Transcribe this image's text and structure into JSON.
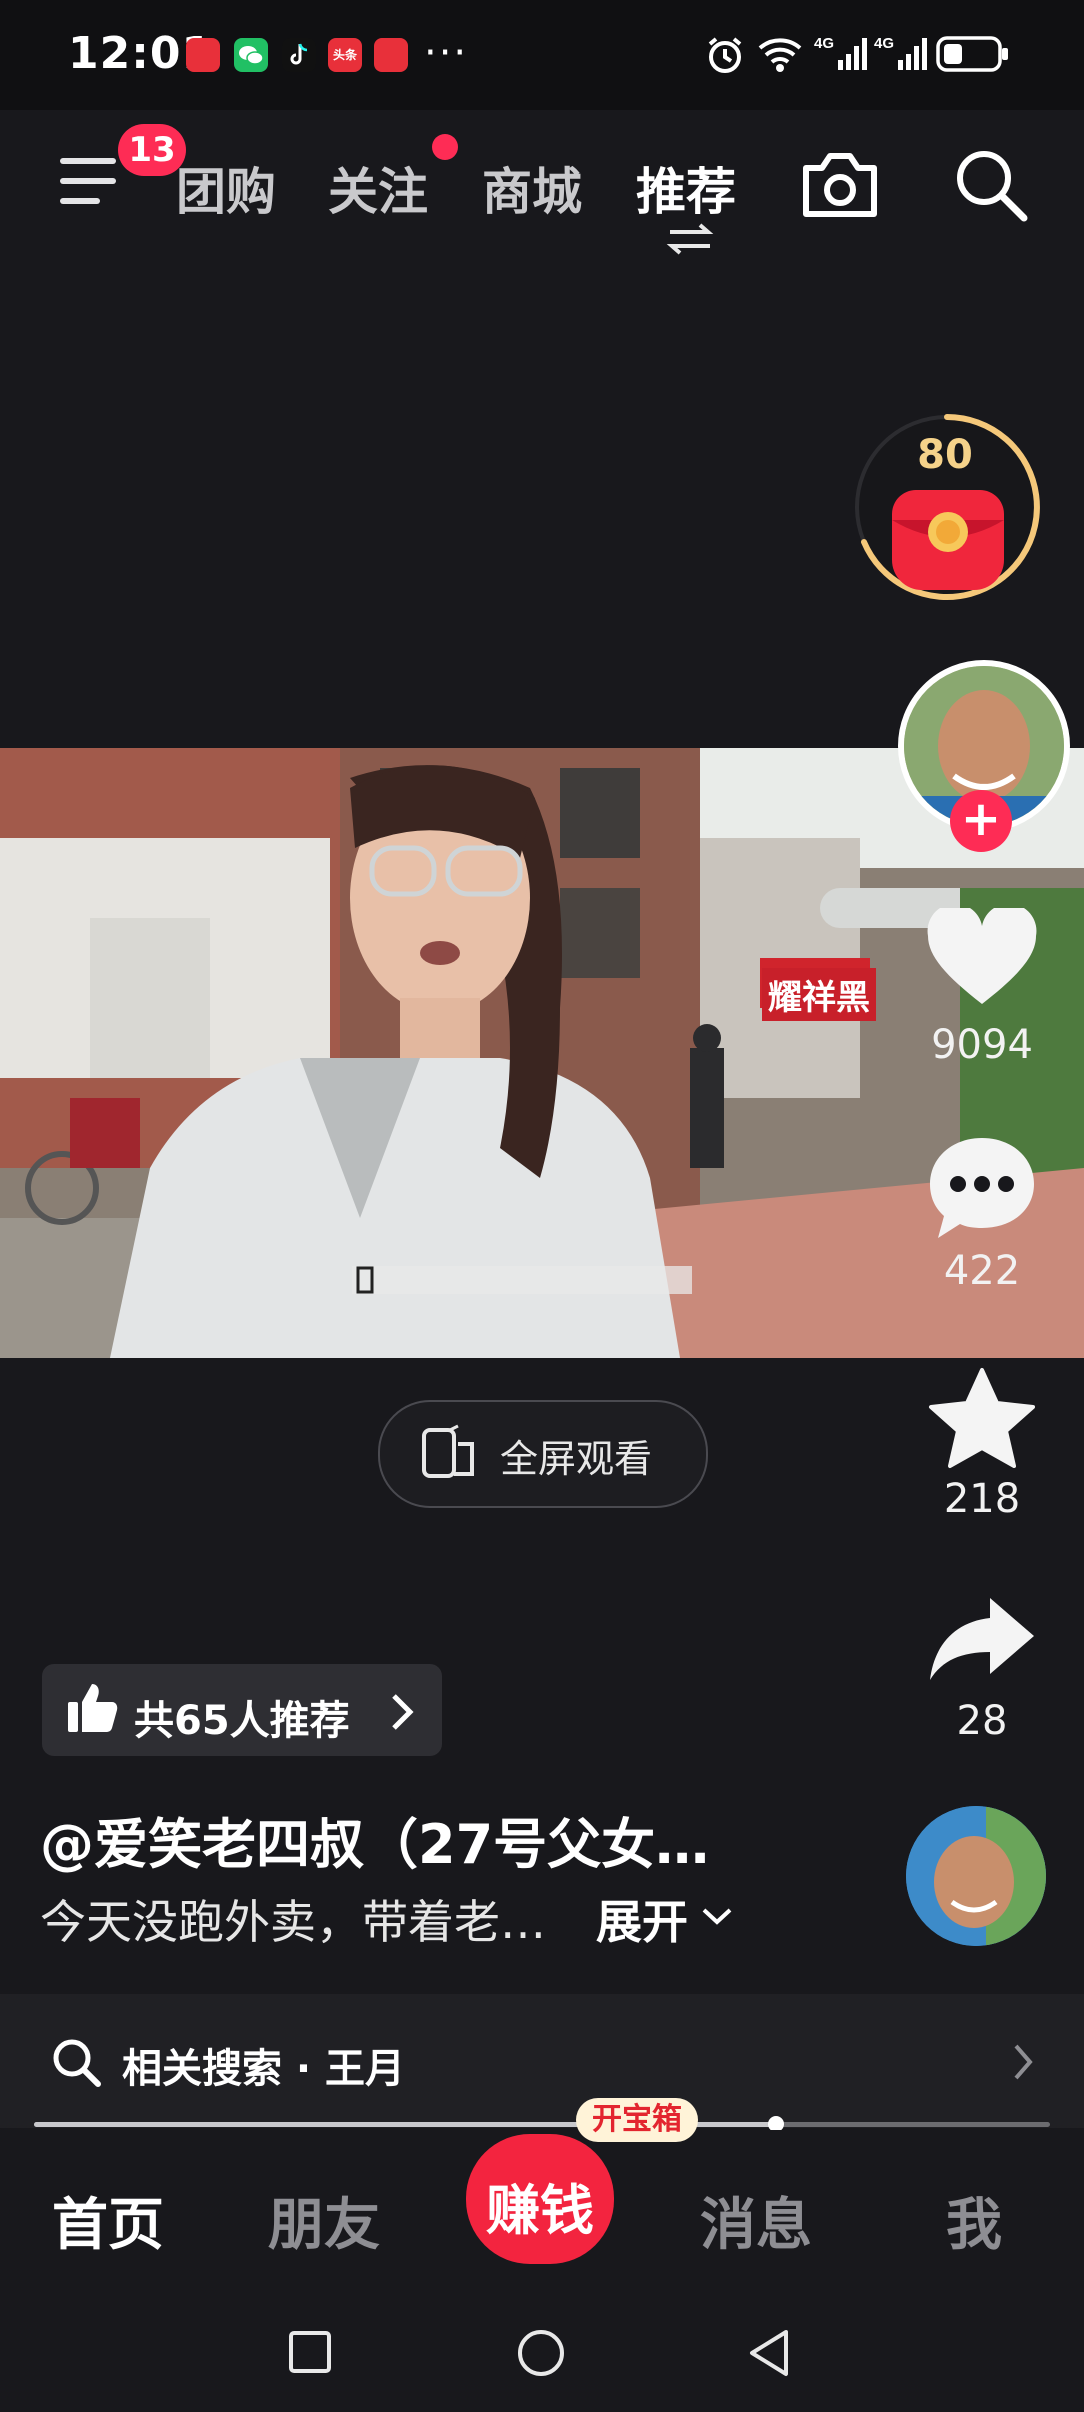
{
  "status_bar": {
    "time": "12:01",
    "more": "···",
    "apps": [
      "huawei-store-icon",
      "wechat-icon",
      "tiktok-icon",
      "toutiao-icon",
      "huawei-store-icon"
    ],
    "system_icons": [
      "alarm-icon",
      "wifi-icon",
      "signal-4g-icon",
      "signal-4g-icon",
      "battery-icon"
    ],
    "toutiao_label": "头条"
  },
  "top_nav": {
    "menu_badge": "13",
    "tabs": [
      {
        "label": "团购"
      },
      {
        "label": "关注"
      },
      {
        "label": "商城"
      },
      {
        "label": "推荐"
      }
    ],
    "active_tab": "推荐",
    "icons": [
      "camera-icon",
      "search-icon"
    ]
  },
  "reward": {
    "coins": "80"
  },
  "right_rail": {
    "likes": "9094",
    "comments": "422",
    "favorites": "218",
    "shares": "28"
  },
  "video": {
    "sign_text": "耀祥黑"
  },
  "fullscreen": {
    "label": "全屏观看"
  },
  "post": {
    "recommend_label": "共65人推荐",
    "author": "@爱笑老四叔（27号父女…",
    "description": "今天没跑外卖，带着老…",
    "expand_label": "展开"
  },
  "search_bar": {
    "label": "相关搜索 · 王月"
  },
  "progress": {
    "fraction": 0.73
  },
  "bottom_nav": {
    "tabs": [
      "首页",
      "朋友",
      "赚钱",
      "消息",
      "我"
    ],
    "active_tab": "首页",
    "treasure_label": "开宝箱"
  },
  "colors": {
    "accent": "#fe2c55",
    "background": "#18181c",
    "earn_red": "#f3243f",
    "coin_gold": "#f5c87a"
  }
}
